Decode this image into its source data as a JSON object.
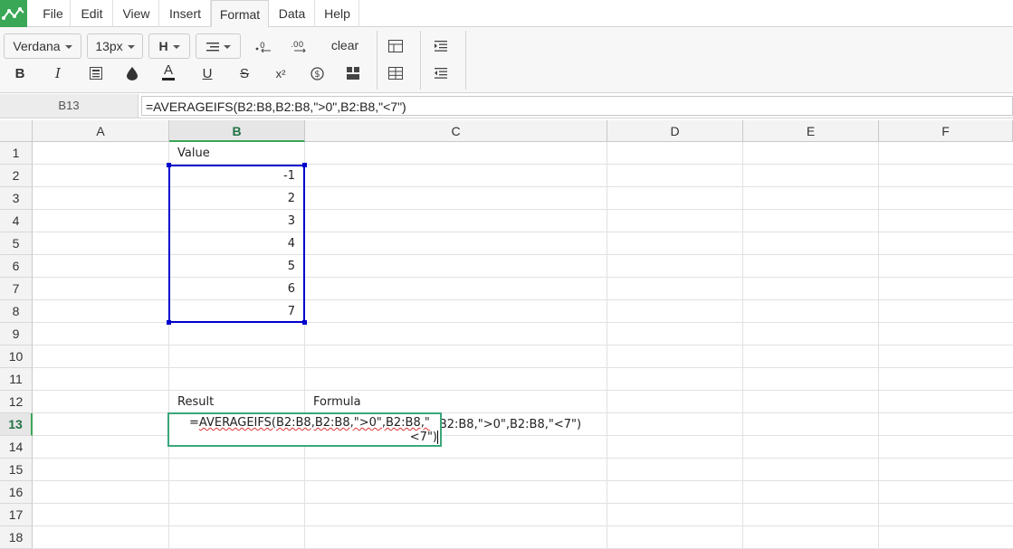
{
  "menu": {
    "items": [
      {
        "label": "File"
      },
      {
        "label": "Edit"
      },
      {
        "label": "View"
      },
      {
        "label": "Insert"
      },
      {
        "label": "Format"
      },
      {
        "label": "Data"
      },
      {
        "label": "Help"
      }
    ],
    "active": "Format"
  },
  "toolbar": {
    "font_family": "Verdana",
    "font_size": "13px",
    "clear_label": "clear",
    "icons": [
      "heading-icon",
      "align-icon",
      "decrease-decimal-icon",
      "increase-decimal-icon",
      "bold-icon",
      "italic-icon",
      "format-cells-icon",
      "fill-color-icon",
      "font-color-icon",
      "underline-icon",
      "strikethrough-icon",
      "superscript-icon",
      "currency-icon",
      "merge-icon",
      "borders-icon",
      "table-icon",
      "indent-icon",
      "outdent-icon"
    ],
    "bold": "B",
    "italic": "I",
    "font_color": "A",
    "underline": "U",
    "strike": "S",
    "superscript": "x²"
  },
  "formula_bar": {
    "cell_ref": "B13",
    "formula": "=AVERAGEIFS(B2:B8,B2:B8,\">0\",B2:B8,\"<7\")"
  },
  "grid": {
    "columns": [
      "A",
      "B",
      "C",
      "D",
      "E",
      "F"
    ],
    "active_column": "B",
    "rows": [
      "1",
      "2",
      "3",
      "4",
      "5",
      "6",
      "7",
      "8",
      "9",
      "10",
      "11",
      "12",
      "13",
      "14",
      "15",
      "16",
      "17",
      "18"
    ],
    "active_row": "13",
    "cells": {
      "B1": "Value",
      "B2": "-1",
      "B3": "2",
      "B4": "3",
      "B5": "4",
      "B6": "5",
      "B7": "6",
      "B8": "7",
      "B12": "Result",
      "C12": "Formula",
      "C13": "=AVERAGEIFS(B2:B8,B2:B8,\">0\",B2:B8,\"<7\")"
    },
    "editor": {
      "line1_prefix": "=",
      "line1_underlined": "AVERAGEIFS(B2:B8,B2:B8,\">0\",B2:B8,\"",
      "line2": "<7\")"
    }
  },
  "colors": {
    "accent": "#3aa757",
    "selection": "#0000cc",
    "editor_border": "#3aa77a"
  }
}
